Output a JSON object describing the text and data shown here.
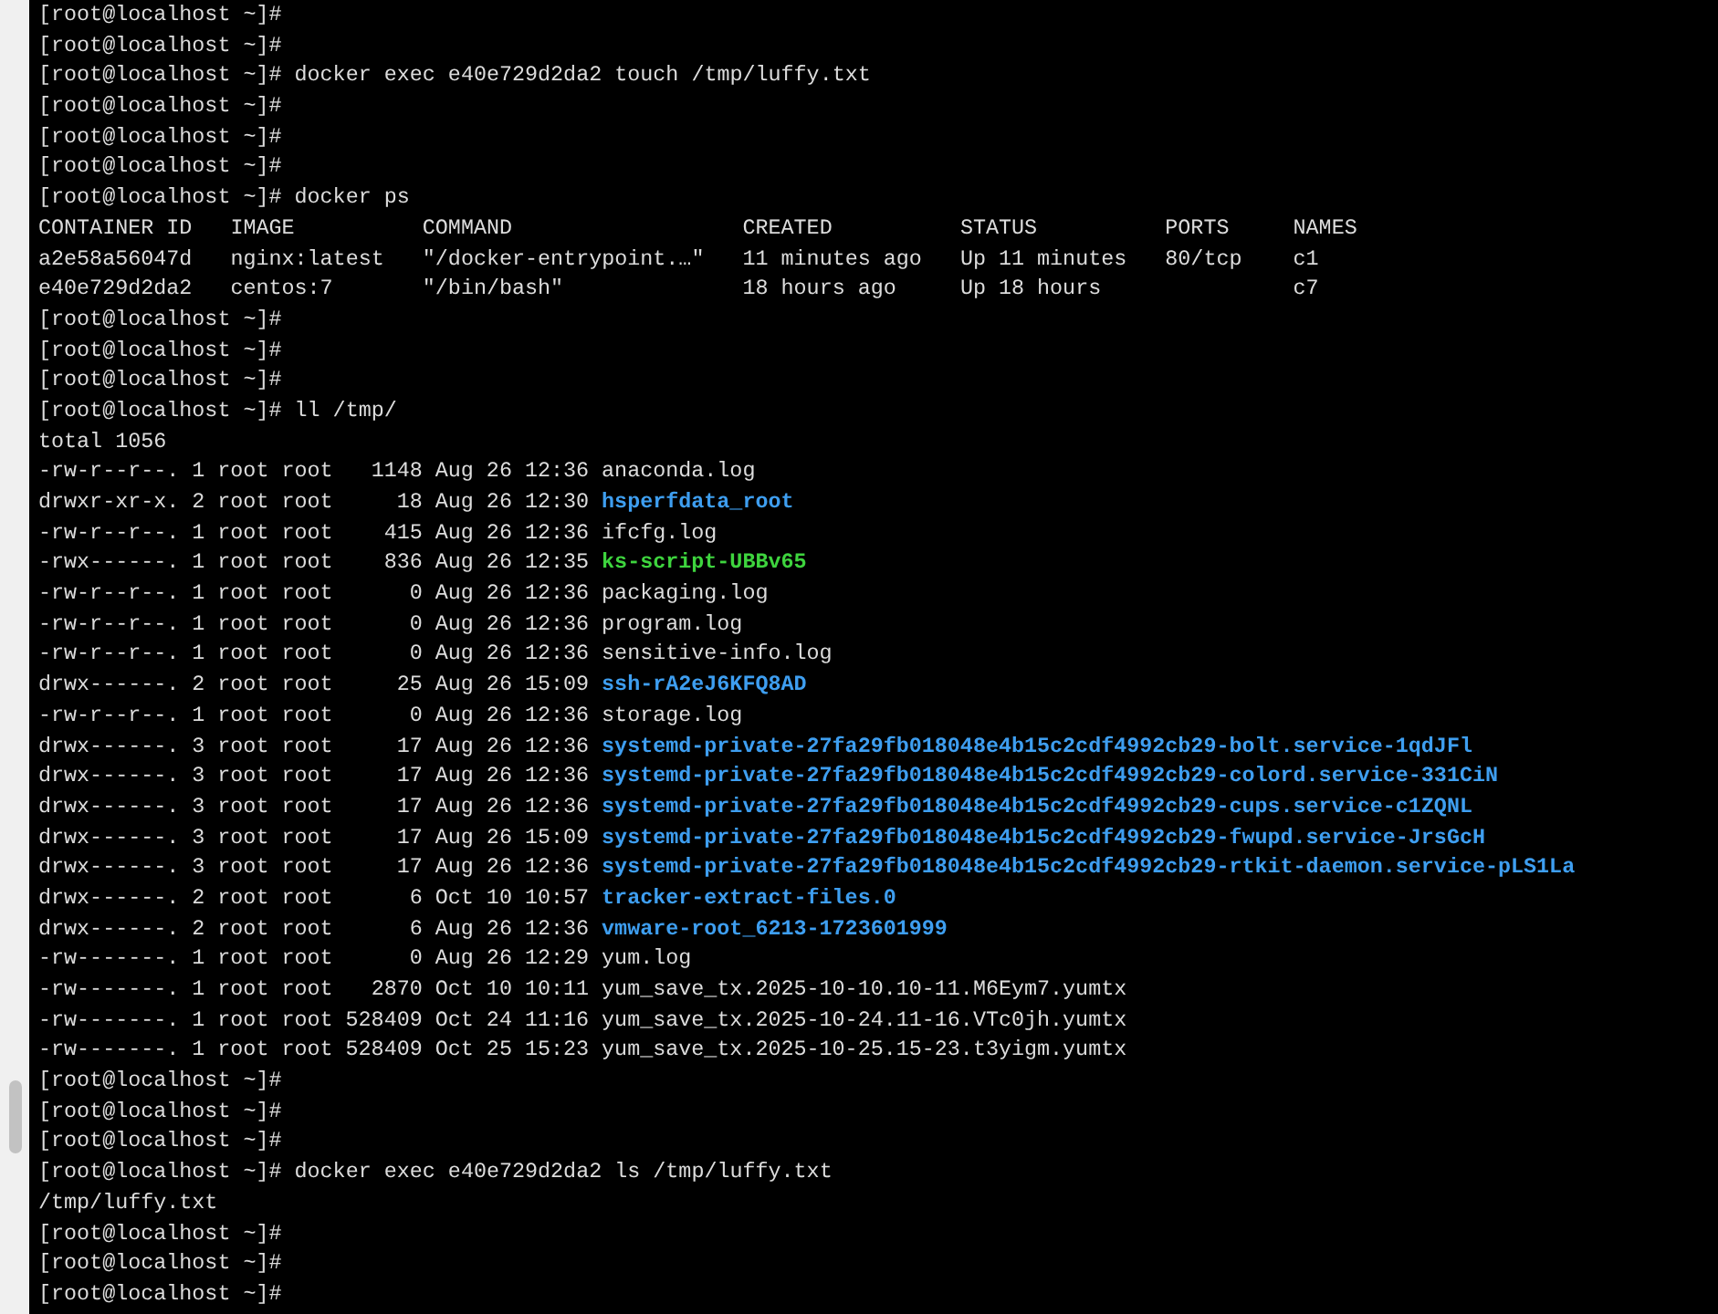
{
  "terminal": {
    "lines": [
      {
        "kind": "prompt",
        "prompt": "[root@localhost ~]#"
      },
      {
        "kind": "prompt",
        "prompt": "[root@localhost ~]#"
      },
      {
        "kind": "prompt",
        "prompt": "[root@localhost ~]#",
        "command": "docker exec e40e729d2da2 touch /tmp/luffy.txt"
      },
      {
        "kind": "prompt",
        "prompt": "[root@localhost ~]#"
      },
      {
        "kind": "prompt",
        "prompt": "[root@localhost ~]#"
      },
      {
        "kind": "prompt",
        "prompt": "[root@localhost ~]#"
      },
      {
        "kind": "prompt",
        "prompt": "[root@localhost ~]#",
        "command": "docker ps"
      },
      {
        "kind": "table",
        "cells": [
          "CONTAINER ID",
          "IMAGE",
          "COMMAND",
          "CREATED",
          "STATUS",
          "PORTS",
          "NAMES"
        ]
      },
      {
        "kind": "table",
        "cells": [
          "a2e58a56047d",
          "nginx:latest",
          "\"/docker-entrypoint.…\"",
          "11 minutes ago",
          "Up 11 minutes",
          "80/tcp",
          "c1"
        ]
      },
      {
        "kind": "table",
        "cells": [
          "e40e729d2da2",
          "centos:7",
          "\"/bin/bash\"",
          "18 hours ago",
          "Up 18 hours",
          "",
          "c7"
        ]
      },
      {
        "kind": "prompt",
        "prompt": "[root@localhost ~]#"
      },
      {
        "kind": "prompt",
        "prompt": "[root@localhost ~]#"
      },
      {
        "kind": "prompt",
        "prompt": "[root@localhost ~]#"
      },
      {
        "kind": "prompt",
        "prompt": "[root@localhost ~]#",
        "command": "ll /tmp/"
      },
      {
        "kind": "output",
        "text": "total 1056"
      },
      {
        "kind": "ls",
        "perms": "-rw-r--r--.",
        "links": "1",
        "owner": "root",
        "group": "root",
        "size": "1148",
        "modified": "Aug 26 12:36",
        "file": {
          "name": "anaconda.log",
          "kind": "file"
        }
      },
      {
        "kind": "ls",
        "perms": "drwxr-xr-x.",
        "links": "2",
        "owner": "root",
        "group": "root",
        "size": "18",
        "modified": "Aug 26 12:30",
        "file": {
          "name": "hsperfdata_root",
          "kind": "dir"
        }
      },
      {
        "kind": "ls",
        "perms": "-rw-r--r--.",
        "links": "1",
        "owner": "root",
        "group": "root",
        "size": "415",
        "modified": "Aug 26 12:36",
        "file": {
          "name": "ifcfg.log",
          "kind": "file"
        }
      },
      {
        "kind": "ls",
        "perms": "-rwx------.",
        "links": "1",
        "owner": "root",
        "group": "root",
        "size": "836",
        "modified": "Aug 26 12:35",
        "file": {
          "name": "ks-script-UBBv65",
          "kind": "exec"
        }
      },
      {
        "kind": "ls",
        "perms": "-rw-r--r--.",
        "links": "1",
        "owner": "root",
        "group": "root",
        "size": "0",
        "modified": "Aug 26 12:36",
        "file": {
          "name": "packaging.log",
          "kind": "file"
        }
      },
      {
        "kind": "ls",
        "perms": "-rw-r--r--.",
        "links": "1",
        "owner": "root",
        "group": "root",
        "size": "0",
        "modified": "Aug 26 12:36",
        "file": {
          "name": "program.log",
          "kind": "file"
        }
      },
      {
        "kind": "ls",
        "perms": "-rw-r--r--.",
        "links": "1",
        "owner": "root",
        "group": "root",
        "size": "0",
        "modified": "Aug 26 12:36",
        "file": {
          "name": "sensitive-info.log",
          "kind": "file"
        }
      },
      {
        "kind": "ls",
        "perms": "drwx------.",
        "links": "2",
        "owner": "root",
        "group": "root",
        "size": "25",
        "modified": "Aug 26 15:09",
        "file": {
          "name": "ssh-rA2eJ6KFQ8AD",
          "kind": "dir"
        }
      },
      {
        "kind": "ls",
        "perms": "-rw-r--r--.",
        "links": "1",
        "owner": "root",
        "group": "root",
        "size": "0",
        "modified": "Aug 26 12:36",
        "file": {
          "name": "storage.log",
          "kind": "file"
        }
      },
      {
        "kind": "ls",
        "perms": "drwx------.",
        "links": "3",
        "owner": "root",
        "group": "root",
        "size": "17",
        "modified": "Aug 26 12:36",
        "file": {
          "name": "systemd-private-27fa29fb018048e4b15c2cdf4992cb29-bolt.service-1qdJFl",
          "kind": "dir"
        }
      },
      {
        "kind": "ls",
        "perms": "drwx------.",
        "links": "3",
        "owner": "root",
        "group": "root",
        "size": "17",
        "modified": "Aug 26 12:36",
        "file": {
          "name": "systemd-private-27fa29fb018048e4b15c2cdf4992cb29-colord.service-331CiN",
          "kind": "dir"
        }
      },
      {
        "kind": "ls",
        "perms": "drwx------.",
        "links": "3",
        "owner": "root",
        "group": "root",
        "size": "17",
        "modified": "Aug 26 12:36",
        "file": {
          "name": "systemd-private-27fa29fb018048e4b15c2cdf4992cb29-cups.service-c1ZQNL",
          "kind": "dir"
        }
      },
      {
        "kind": "ls",
        "perms": "drwx------.",
        "links": "3",
        "owner": "root",
        "group": "root",
        "size": "17",
        "modified": "Aug 26 15:09",
        "file": {
          "name": "systemd-private-27fa29fb018048e4b15c2cdf4992cb29-fwupd.service-JrsGcH",
          "kind": "dir"
        }
      },
      {
        "kind": "ls",
        "perms": "drwx------.",
        "links": "3",
        "owner": "root",
        "group": "root",
        "size": "17",
        "modified": "Aug 26 12:36",
        "file": {
          "name": "systemd-private-27fa29fb018048e4b15c2cdf4992cb29-rtkit-daemon.service-pLS1La",
          "kind": "dir"
        }
      },
      {
        "kind": "ls",
        "perms": "drwx------.",
        "links": "2",
        "owner": "root",
        "group": "root",
        "size": "6",
        "modified": "Oct 10 10:57",
        "file": {
          "name": "tracker-extract-files.0",
          "kind": "dir"
        }
      },
      {
        "kind": "ls",
        "perms": "drwx------.",
        "links": "2",
        "owner": "root",
        "group": "root",
        "size": "6",
        "modified": "Aug 26 12:36",
        "file": {
          "name": "vmware-root_6213-1723601999",
          "kind": "dir"
        }
      },
      {
        "kind": "ls",
        "perms": "-rw-------.",
        "links": "1",
        "owner": "root",
        "group": "root",
        "size": "0",
        "modified": "Aug 26 12:29",
        "file": {
          "name": "yum.log",
          "kind": "file"
        }
      },
      {
        "kind": "ls",
        "perms": "-rw-------.",
        "links": "1",
        "owner": "root",
        "group": "root",
        "size": "2870",
        "modified": "Oct 10 10:11",
        "file": {
          "name": "yum_save_tx.2025-10-10.10-11.M6Eym7.yumtx",
          "kind": "file"
        }
      },
      {
        "kind": "ls",
        "perms": "-rw-------.",
        "links": "1",
        "owner": "root",
        "group": "root",
        "size": "528409",
        "modified": "Oct 24 11:16",
        "file": {
          "name": "yum_save_tx.2025-10-24.11-16.VTc0jh.yumtx",
          "kind": "file"
        }
      },
      {
        "kind": "ls",
        "perms": "-rw-------.",
        "links": "1",
        "owner": "root",
        "group": "root",
        "size": "528409",
        "modified": "Oct 25 15:23",
        "file": {
          "name": "yum_save_tx.2025-10-25.15-23.t3yigm.yumtx",
          "kind": "file"
        }
      },
      {
        "kind": "prompt",
        "prompt": "[root@localhost ~]#"
      },
      {
        "kind": "prompt",
        "prompt": "[root@localhost ~]#"
      },
      {
        "kind": "prompt",
        "prompt": "[root@localhost ~]#"
      },
      {
        "kind": "prompt",
        "prompt": "[root@localhost ~]#",
        "command": "docker exec e40e729d2da2 ls /tmp/luffy.txt"
      },
      {
        "kind": "output",
        "text": "/tmp/luffy.txt"
      },
      {
        "kind": "prompt",
        "prompt": "[root@localhost ~]#"
      },
      {
        "kind": "prompt",
        "prompt": "[root@localhost ~]#"
      },
      {
        "kind": "prompt",
        "prompt": "[root@localhost ~]#"
      }
    ]
  }
}
